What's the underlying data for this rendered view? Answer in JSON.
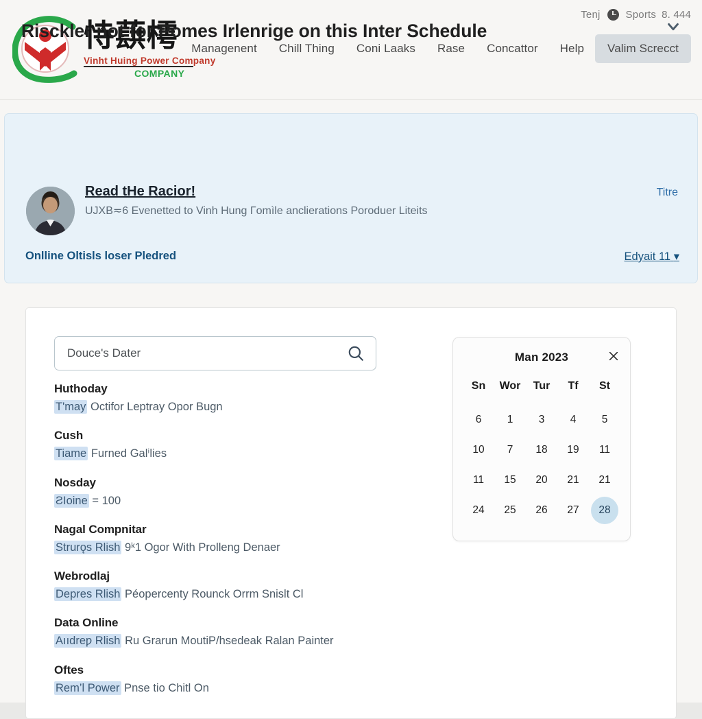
{
  "topbar": {
    "label": "Tenj",
    "clock_icon": "clock-icon",
    "sports": "Sports",
    "value": "8. 444"
  },
  "header": {
    "logo": {
      "cjk": "恃蕻樗",
      "english": "Vinht Huing Power Company",
      "english2": "COMPANY",
      "mark_green": "#2aa84a",
      "mark_red": "#cf2b2b"
    },
    "nav": [
      {
        "label": "Managenent",
        "active": false
      },
      {
        "label": "Chill Thing",
        "active": false
      },
      {
        "label": "Coni Laaks",
        "active": false
      },
      {
        "label": "Rase",
        "active": false
      },
      {
        "label": "Concattor",
        "active": false
      },
      {
        "label": "Help",
        "active": false
      },
      {
        "label": "Valim Screcct",
        "active": true
      }
    ]
  },
  "banner": {
    "title": "Risckler not for Pomes Irlenrige on this Inter Schedule",
    "chevron_icon": "chevron-down-icon",
    "avatar": "avatar",
    "link": "Read tHe Racior!",
    "subtitle": "UJXB≂6 Evenetted to Vinh Hung Γomìle anclierations Poroduer Liteits",
    "titre": "Titre",
    "footer_link": "Onlline Oltisls loser Pledred",
    "edit_link": "Edyait 11",
    "edit_caret": "chevron-down-icon",
    "background": "#e8f2f9"
  },
  "search": {
    "value": "Douce's Dater",
    "placeholder": "Douce's Dater",
    "icon": "search-icon"
  },
  "list": [
    {
      "title": "Huthoday",
      "highlight": "T'may",
      "rest": "Octifor Leptray Opor Bugn"
    },
    {
      "title": "Cush",
      "highlight": "Tiame",
      "rest": "Furned Galⁱlies"
    },
    {
      "title": "Nosday",
      "highlight": "ƧIoine",
      "rest": "= 100"
    },
    {
      "title": "Nagal Compnitar",
      "highlight": "Strurǫs Rlish",
      "rest": "9ᵏ1 Ogor With Prolleng Denaer"
    },
    {
      "title": "Webrodlaj",
      "highlight": "Depres Rlish",
      "rest": "Péopercenty Rounck Orrm Snislt Cl"
    },
    {
      "title": "Data Online",
      "highlight": "Aııdreƿ Rlish",
      "rest": "Ru Grarun MoutiP/hsedeak Ralan Painter"
    },
    {
      "title": "Oftes",
      "highlight": "Rem’l Power",
      "rest": "Pnse tiᴏ Chitl On"
    }
  ],
  "calendar": {
    "month": "Man 2023",
    "close_icon": "close-icon",
    "dow": [
      "Sn",
      "Wor",
      "Tur",
      "Tf",
      "St"
    ],
    "weeks": [
      [
        "6",
        "1",
        "3",
        "4",
        "5"
      ],
      [
        "10",
        "7",
        "18",
        "19",
        "11"
      ],
      [
        "11",
        "15",
        "20",
        "21",
        "21"
      ],
      [
        "24",
        "25",
        "26",
        "27",
        "28"
      ]
    ],
    "selected": "28",
    "selected_color": "#c9e0ee"
  }
}
